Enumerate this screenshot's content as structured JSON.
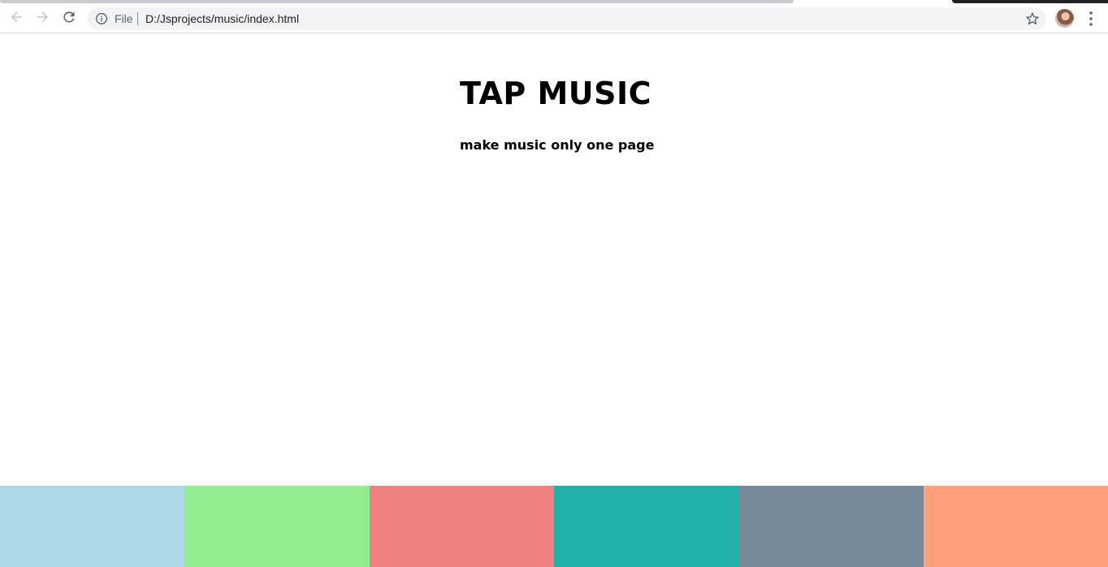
{
  "browser": {
    "scheme_label": "File",
    "url": "D:/Jsprojects/music/index.html",
    "icons": {
      "back": "arrow-left-icon",
      "forward": "arrow-right-icon",
      "reload": "reload-icon",
      "info": "info-icon",
      "bookmark": "star-icon",
      "menu": "kebab-menu-icon"
    }
  },
  "page": {
    "title": "TAP MUSIC",
    "subtitle": "make music only one page"
  },
  "pads": [
    {
      "color": "#add8e6"
    },
    {
      "color": "#90ee90"
    },
    {
      "color": "#f08080"
    },
    {
      "color": "#20b2aa"
    },
    {
      "color": "#778899"
    },
    {
      "color": "#ffa07a"
    }
  ]
}
